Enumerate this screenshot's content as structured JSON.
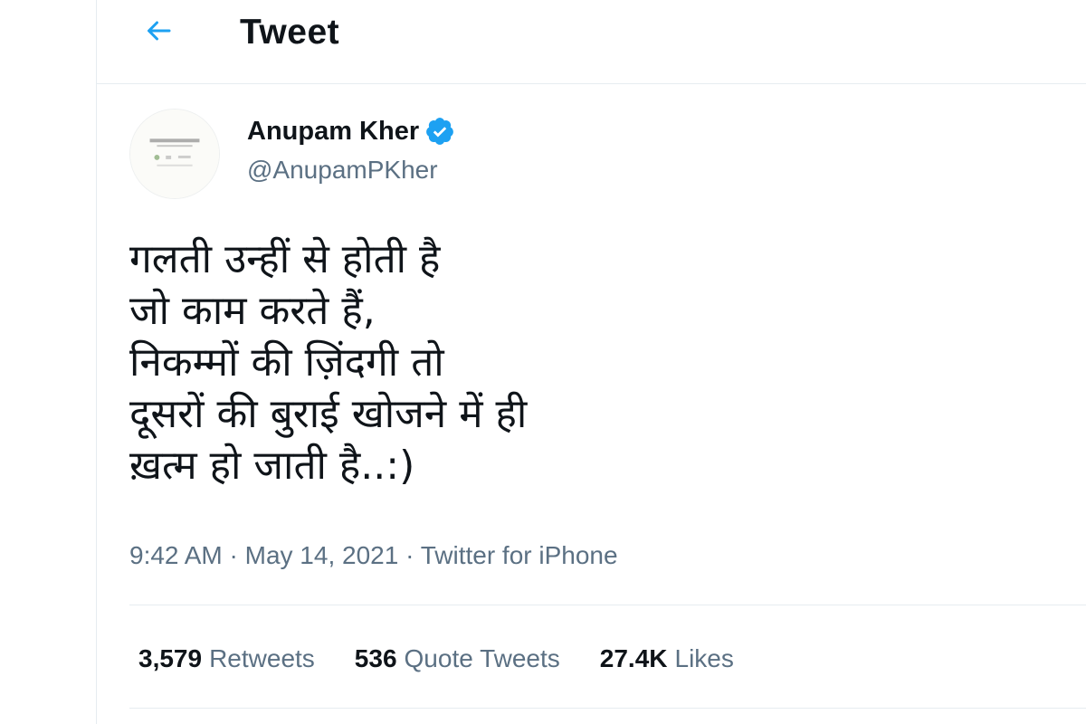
{
  "header": {
    "title": "Tweet",
    "back_icon": "arrow-left-icon",
    "accent_color": "#1da1f2"
  },
  "author": {
    "display_name": "Anupam Kher",
    "handle": "@AnupamPKher",
    "verified_icon": "verified-badge-icon",
    "verified_color": "#1da1f2"
  },
  "tweet": {
    "lines": [
      "गलती उन्हीं से होती है",
      "जो काम करते हैं,",
      "निकम्मों की ज़िंदगी तो",
      "दूसरों की बुराई खोजने में ही",
      "ख़त्म हो जाती है..:)"
    ],
    "time": "9:42 AM",
    "date": "May 14, 2021",
    "source": "Twitter for iPhone",
    "separator": " · "
  },
  "stats": {
    "retweets": {
      "count": "3,579",
      "label": "Retweets"
    },
    "quote_tweets": {
      "count": "536",
      "label": "Quote Tweets"
    },
    "likes": {
      "count": "27.4K",
      "label": "Likes"
    }
  }
}
